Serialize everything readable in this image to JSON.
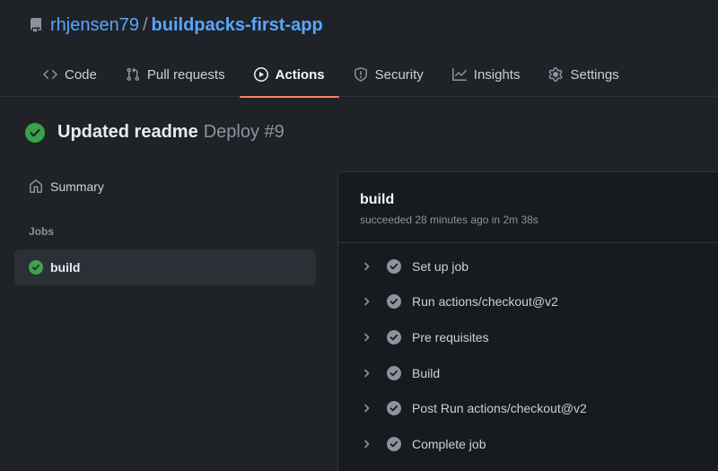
{
  "repo": {
    "owner": "rhjensen79",
    "separator": "/",
    "name": "buildpacks-first-app"
  },
  "tabs": [
    {
      "label": "Code",
      "icon": "code-icon"
    },
    {
      "label": "Pull requests",
      "icon": "pull-request-icon"
    },
    {
      "label": "Actions",
      "icon": "play-icon",
      "active": true
    },
    {
      "label": "Security",
      "icon": "shield-icon"
    },
    {
      "label": "Insights",
      "icon": "graph-icon"
    },
    {
      "label": "Settings",
      "icon": "gear-icon"
    }
  ],
  "run": {
    "commit_message": "Updated readme",
    "workflow_label": "Deploy #9",
    "status": "success"
  },
  "sidebar": {
    "summary_label": "Summary",
    "jobs_heading": "Jobs",
    "jobs": [
      {
        "label": "build",
        "status": "success"
      }
    ]
  },
  "job": {
    "name": "build",
    "status_text": "succeeded 28 minutes ago in 2m 38s",
    "steps": [
      {
        "label": "Set up job"
      },
      {
        "label": "Run actions/checkout@v2"
      },
      {
        "label": "Pre requisites"
      },
      {
        "label": "Build"
      },
      {
        "label": "Post Run actions/checkout@v2"
      },
      {
        "label": "Complete job"
      }
    ]
  },
  "colors": {
    "accent_link": "#58a6ff",
    "tab_underline": "#f78166",
    "success_green": "#3fb950",
    "step_check_gray": "#8b949e"
  }
}
